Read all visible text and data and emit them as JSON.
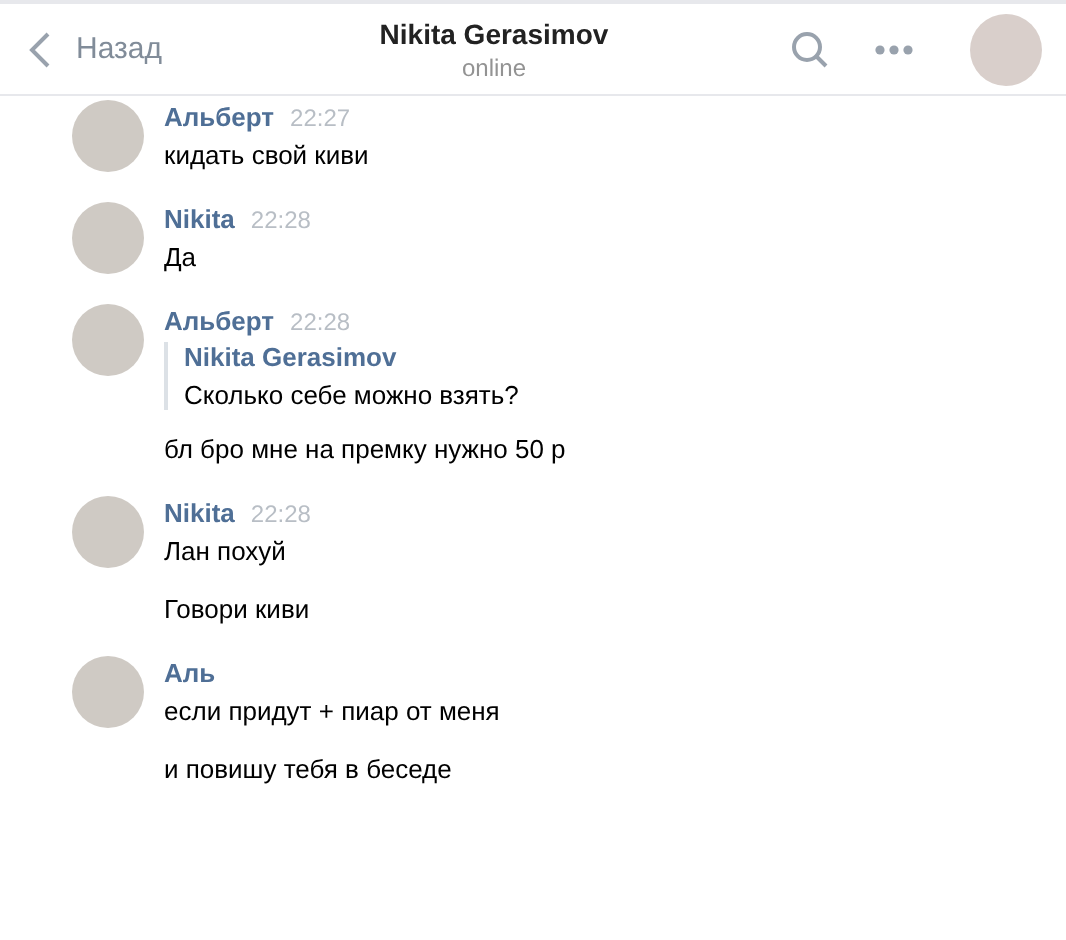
{
  "header": {
    "back": "Назад",
    "title": "Nikita Gerasimov",
    "status": "online"
  },
  "messages": [
    {
      "sender": "Альберт",
      "time": "22:27",
      "lines": [
        "кидать свой киви"
      ]
    },
    {
      "sender": "Nikita",
      "time": "22:28",
      "lines": [
        "Да"
      ]
    },
    {
      "sender": "Альберт",
      "time": "22:28",
      "reply": {
        "sender": "Nikita Gerasimov",
        "text": "Сколько себе можно взять?"
      },
      "lines": [
        "бл бро мне на премку нужно 50 р"
      ]
    },
    {
      "sender": "Nikita",
      "time": "22:28",
      "lines": [
        "Лан похуй",
        "Говори киви"
      ]
    },
    {
      "sender": "Аль",
      "lines": [
        "если придут + пиар от меня",
        "и повишу тебя в беседе"
      ]
    }
  ]
}
